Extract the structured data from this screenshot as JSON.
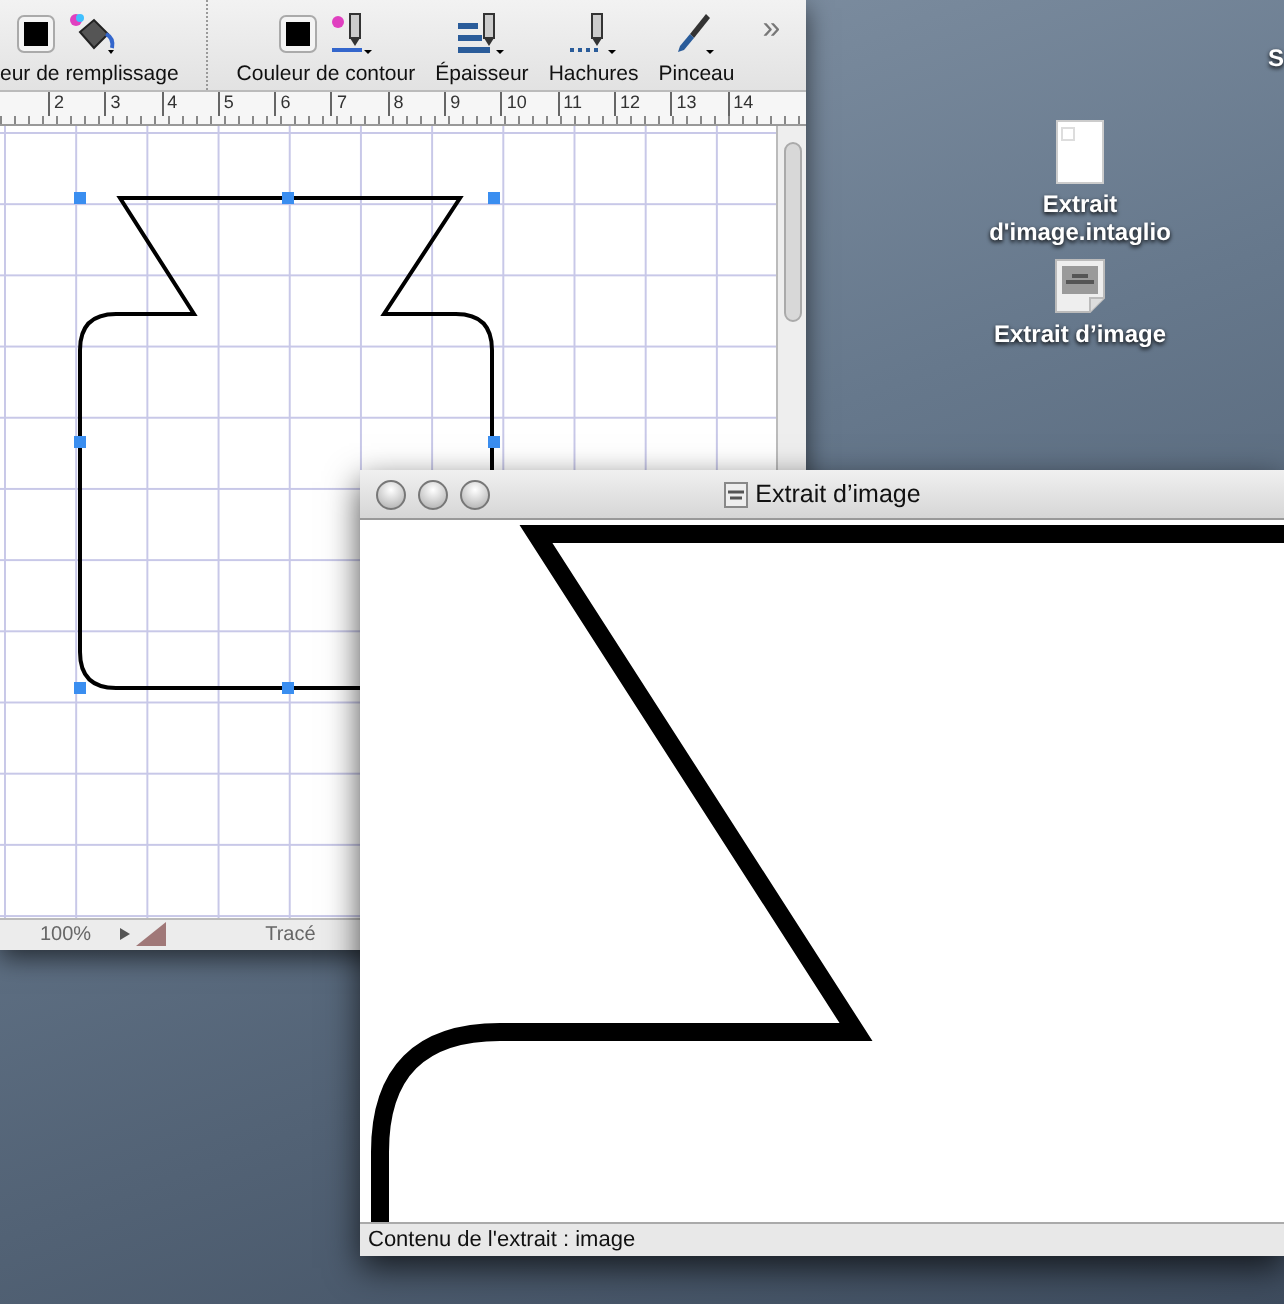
{
  "main_window": {
    "toolbar": [
      {
        "label": "eur de remplissage",
        "kind": "fill"
      },
      {
        "label": "Couleur de contour",
        "kind": "stroke"
      },
      {
        "label": "Épaisseur",
        "kind": "weight"
      },
      {
        "label": "Hachures",
        "kind": "dash"
      },
      {
        "label": "Pinceau",
        "kind": "brush"
      }
    ],
    "overflow": "»",
    "ruler": [
      "2",
      "3",
      "4",
      "5",
      "6",
      "7",
      "8",
      "9",
      "10",
      "11",
      "12",
      "13",
      "14"
    ],
    "status_bar": {
      "zoom": "100%",
      "mode": "Tracé"
    }
  },
  "desktop": {
    "edge_text": "S",
    "icons": [
      {
        "label": "Extrait d'image.intaglio",
        "kind": "document"
      },
      {
        "label": "Extrait d’image",
        "kind": "clipping"
      }
    ]
  },
  "clipping_window": {
    "title": "Extrait d’image",
    "status_bar": "Contenu de l'extrait : image"
  }
}
